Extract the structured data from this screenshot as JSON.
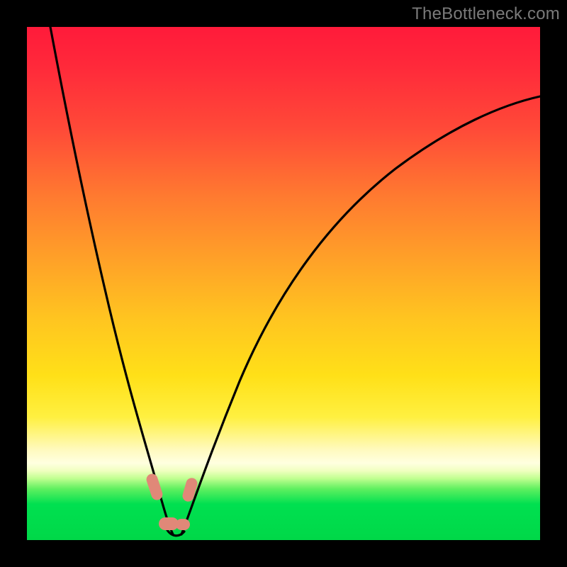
{
  "watermark": "TheBottleneck.com",
  "colors": {
    "frame": "#000000",
    "gradient_top": "#ff1a3a",
    "gradient_mid": "#ffe018",
    "gradient_bottom": "#00d848",
    "curve": "#000000",
    "marker": "#e08878"
  },
  "chart_data": {
    "type": "line",
    "title": "",
    "xlabel": "",
    "ylabel": "",
    "xlim": [
      0,
      100
    ],
    "ylim": [
      0,
      100
    ],
    "notes": "No axis ticks or numeric labels are rendered; values below are pixel-read estimates normalized to 0–100 on each axis. The plotted quantity appears to be a bottleneck/mismatch percentage that dips to ~0 near x≈29 and rises sharply on either side.",
    "series": [
      {
        "name": "left-branch",
        "x": [
          4.5,
          6,
          8,
          10,
          12,
          14,
          16,
          18,
          20,
          22,
          24,
          25.5,
          27,
          28.5
        ],
        "values": [
          100,
          92,
          82,
          73,
          64,
          55,
          47,
          39,
          31,
          23,
          15,
          10,
          5,
          1
        ]
      },
      {
        "name": "right-branch",
        "x": [
          30,
          31.5,
          33,
          35,
          38,
          42,
          47,
          53,
          60,
          68,
          77,
          87,
          97,
          100
        ],
        "values": [
          1,
          5,
          10,
          17,
          26,
          36,
          46,
          55,
          63,
          70,
          76,
          81,
          85,
          86
        ]
      }
    ],
    "markers": [
      {
        "x": 25.0,
        "y": 9.0
      },
      {
        "x": 26.8,
        "y": 2.5
      },
      {
        "x": 29.8,
        "y": 2.0
      },
      {
        "x": 31.8,
        "y": 8.5
      }
    ]
  }
}
